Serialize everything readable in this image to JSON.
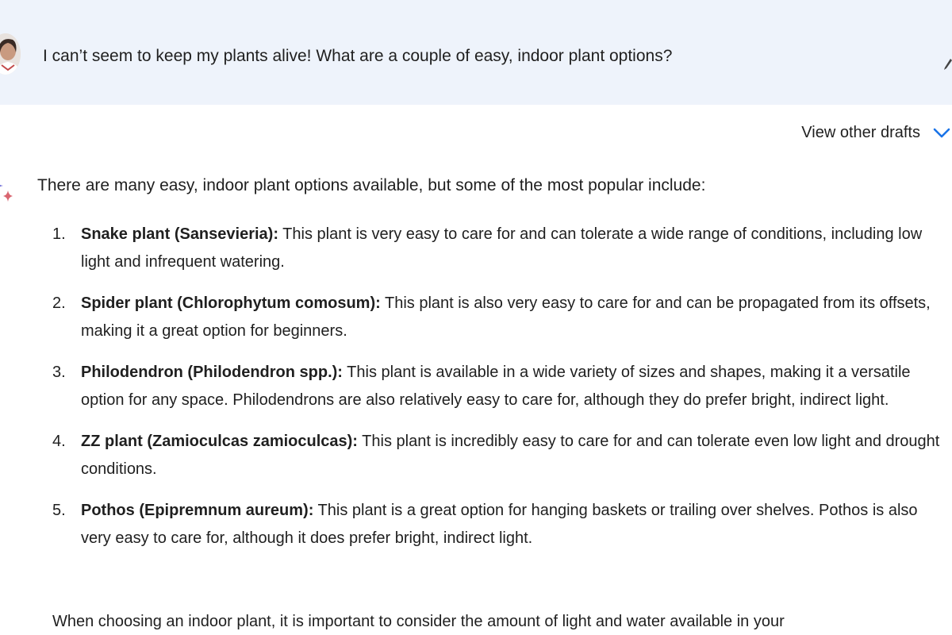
{
  "prompt": {
    "text": "I can’t seem to keep my plants alive! What are a couple of easy, indoor plant options?"
  },
  "drafts": {
    "label": "View other drafts",
    "icon": "chevron-down-icon"
  },
  "response": {
    "icon": "sparkle-icon",
    "intro": "There are many easy, indoor plant options available, but some of the most popular include:",
    "items": [
      {
        "number": "1.",
        "title": "Snake plant (Sansevieria):",
        "body": " This plant is very easy to care for and can tolerate a wide range of conditions, including low light and infrequent watering."
      },
      {
        "number": "2.",
        "title": "Spider plant (Chlorophytum comosum):",
        "body": " This plant is also very easy to care for and can be propagated from its offsets, making it a great option for beginners."
      },
      {
        "number": "3.",
        "title": "Philodendron (Philodendron spp.):",
        "body": " This plant is available in a wide variety of sizes and shapes, making it a versatile option for any space. Philodendrons are also relatively easy to care for, although they do prefer bright, indirect light."
      },
      {
        "number": "4.",
        "title": "ZZ plant (Zamioculcas zamioculcas):",
        "body": " This plant is incredibly easy to care for and can tolerate even low light and drought conditions."
      },
      {
        "number": "5.",
        "title": "Pothos (Epipremnum aureum):",
        "body": " This plant is a great option for hanging baskets or trailing over shelves. Pothos is also very easy to care for, although it does prefer bright, indirect light."
      }
    ],
    "closing": "When choosing an indoor plant, it is important to consider the amount of light and water available in your"
  },
  "colors": {
    "prompt_background": "#eef3fb",
    "accent_blue": "#1a73e8",
    "text": "#1f1f1f"
  }
}
